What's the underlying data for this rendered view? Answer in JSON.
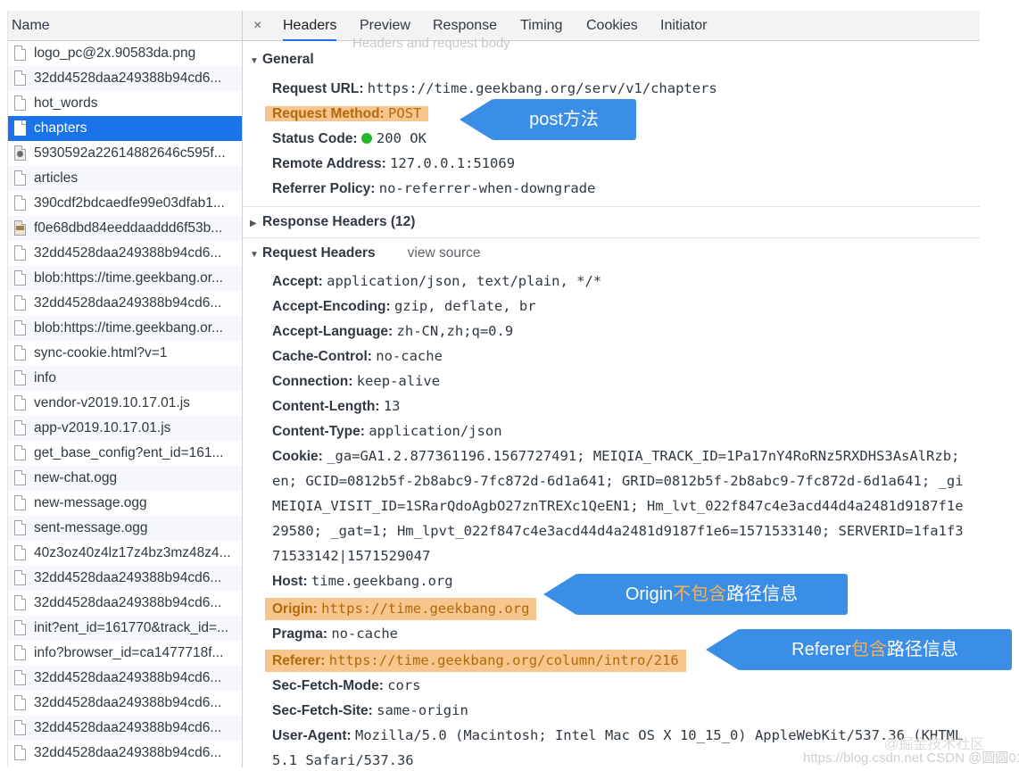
{
  "requests": {
    "header": "Name",
    "items": [
      {
        "name": "logo_pc@2x.90583da.png",
        "icon": "file-icon",
        "selected": false
      },
      {
        "name": "32dd4528daa249388b94cd6...",
        "icon": "file-icon",
        "selected": false
      },
      {
        "name": "hot_words",
        "icon": "file-icon",
        "selected": false
      },
      {
        "name": "chapters",
        "icon": "file-icon",
        "selected": true
      },
      {
        "name": "5930592a22614882646c595f...",
        "icon": "image-file-icon",
        "selected": false
      },
      {
        "name": "articles",
        "icon": "file-icon",
        "selected": false
      },
      {
        "name": "390cdf2bdcaedfe99e03dfab1...",
        "icon": "file-icon",
        "selected": false
      },
      {
        "name": "f0e68dbd84eeddaaddd6f53b...",
        "icon": "image-file-icon-2",
        "selected": false
      },
      {
        "name": "32dd4528daa249388b94cd6...",
        "icon": "file-icon",
        "selected": false
      },
      {
        "name": "blob:https://time.geekbang.or...",
        "icon": "file-icon",
        "selected": false
      },
      {
        "name": "32dd4528daa249388b94cd6...",
        "icon": "file-icon",
        "selected": false
      },
      {
        "name": "blob:https://time.geekbang.or...",
        "icon": "file-icon",
        "selected": false
      },
      {
        "name": "sync-cookie.html?v=1",
        "icon": "file-icon",
        "selected": false
      },
      {
        "name": "info",
        "icon": "file-icon",
        "selected": false
      },
      {
        "name": "vendor-v2019.10.17.01.js",
        "icon": "file-icon",
        "selected": false
      },
      {
        "name": "app-v2019.10.17.01.js",
        "icon": "file-icon",
        "selected": false
      },
      {
        "name": "get_base_config?ent_id=161...",
        "icon": "file-icon",
        "selected": false
      },
      {
        "name": "new-chat.ogg",
        "icon": "file-icon",
        "selected": false
      },
      {
        "name": "new-message.ogg",
        "icon": "file-icon",
        "selected": false
      },
      {
        "name": "sent-message.ogg",
        "icon": "file-icon",
        "selected": false
      },
      {
        "name": "40z3oz40z4lz17z4bz3mz48z4...",
        "icon": "file-icon",
        "selected": false
      },
      {
        "name": "32dd4528daa249388b94cd6...",
        "icon": "file-icon",
        "selected": false
      },
      {
        "name": "32dd4528daa249388b94cd6...",
        "icon": "file-icon",
        "selected": false
      },
      {
        "name": "init?ent_id=161770&track_id=...",
        "icon": "file-icon",
        "selected": false
      },
      {
        "name": "info?browser_id=ca1477718f...",
        "icon": "file-icon",
        "selected": false
      },
      {
        "name": "32dd4528daa249388b94cd6...",
        "icon": "file-icon",
        "selected": false
      },
      {
        "name": "32dd4528daa249388b94cd6...",
        "icon": "file-icon",
        "selected": false
      },
      {
        "name": "32dd4528daa249388b94cd6...",
        "icon": "file-icon",
        "selected": false
      },
      {
        "name": "32dd4528daa249388b94cd6...",
        "icon": "file-icon",
        "selected": false
      }
    ]
  },
  "tabs": {
    "close": "×",
    "items": [
      "Headers",
      "Preview",
      "Response",
      "Timing",
      "Cookies",
      "Initiator"
    ],
    "active": "Headers",
    "tooltip": "Headers and request body"
  },
  "general": {
    "title": "General",
    "request_url_label": "Request URL:",
    "request_url": "https://time.geekbang.org/serv/v1/chapters",
    "request_method_label": "Request Method:",
    "request_method": "POST",
    "status_code_label": "Status Code:",
    "status_code": "200 OK",
    "remote_address_label": "Remote Address:",
    "remote_address": "127.0.0.1:51069",
    "referrer_policy_label": "Referrer Policy:",
    "referrer_policy": "no-referrer-when-downgrade"
  },
  "response_headers": {
    "title": "Response Headers (12)"
  },
  "request_headers": {
    "title": "Request Headers",
    "view_source": "view source",
    "accept_label": "Accept:",
    "accept": "application/json, text/plain, */*",
    "accept_encoding_label": "Accept-Encoding:",
    "accept_encoding": "gzip, deflate, br",
    "accept_language_label": "Accept-Language:",
    "accept_language": "zh-CN,zh;q=0.9",
    "cache_control_label": "Cache-Control:",
    "cache_control": "no-cache",
    "connection_label": "Connection:",
    "connection": "keep-alive",
    "content_length_label": "Content-Length:",
    "content_length": "13",
    "content_type_label": "Content-Type:",
    "content_type": "application/json",
    "cookie_label": "Cookie:",
    "cookie_line1": "_ga=GA1.2.877361196.1567727491; MEIQIA_TRACK_ID=1Pa17nY4RoRNz5RXDHS3AsAlRzb;",
    "cookie_line2": "en; GCID=0812b5f-2b8abc9-7fc872d-6d1a641; GRID=0812b5f-2b8abc9-7fc872d-6d1a641; _gi",
    "cookie_line3": "MEIQIA_VISIT_ID=1SRarQdoAgbO27znTREXc1QeEN1; Hm_lvt_022f847c4e3acd44d4a2481d9187f1e",
    "cookie_line4": "29580; _gat=1; Hm_lpvt_022f847c4e3acd44d4a2481d9187f1e6=1571533140; SERVERID=1fa1f3",
    "cookie_line5": "71533142|1571529047",
    "host_label": "Host:",
    "host": "time.geekbang.org",
    "origin_label": "Origin:",
    "origin": "https://time.geekbang.org",
    "pragma_label": "Pragma:",
    "pragma": "no-cache",
    "referer_label": "Referer:",
    "referer": "https://time.geekbang.org/column/intro/216",
    "sec_fetch_mode_label": "Sec-Fetch-Mode:",
    "sec_fetch_mode": "cors",
    "sec_fetch_site_label": "Sec-Fetch-Site:",
    "sec_fetch_site": "same-origin",
    "user_agent_label": "User-Agent:",
    "user_agent_line1": "Mozilla/5.0 (Macintosh; Intel Mac OS X 10_15_0) AppleWebKit/537.36 (KHTML",
    "user_agent_line2": "5.1 Safari/537.36"
  },
  "callouts": {
    "post": "post方法",
    "origin_a": "Origin",
    "origin_b": "不包含",
    "origin_c": "路径信息",
    "referer_a": "Referer",
    "referer_b": "包含",
    "referer_c": "路径信息"
  },
  "watermark": {
    "juejin": "@掘金技术社区",
    "csdn": "https://blog.csdn.net CSDN @圆圆01"
  },
  "colors": {
    "selected_row": "#1a73e8",
    "highlight": "#f7c58e",
    "callout": "#3a8ee6",
    "status_ok": "#27b52a"
  }
}
